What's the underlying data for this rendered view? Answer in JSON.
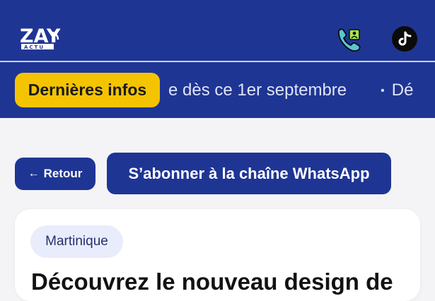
{
  "header": {
    "logo_text": "ZAY",
    "logo_subtext": "ACTU"
  },
  "ticker": {
    "label": "Dernières infos",
    "items": [
      "e dès ce 1er septembre",
      "Dé"
    ],
    "separator": "•"
  },
  "actions": {
    "back_label": "Retour",
    "back_arrow": "←",
    "whatsapp_label": "S’abonner à la chaîne WhatsApp"
  },
  "article": {
    "category": "Martinique",
    "title": "Découvrez le nouveau design de"
  },
  "colors": {
    "brand_blue": "#1f3594",
    "badge_yellow": "#f5c400",
    "tag_bg": "#e9ecfb"
  }
}
